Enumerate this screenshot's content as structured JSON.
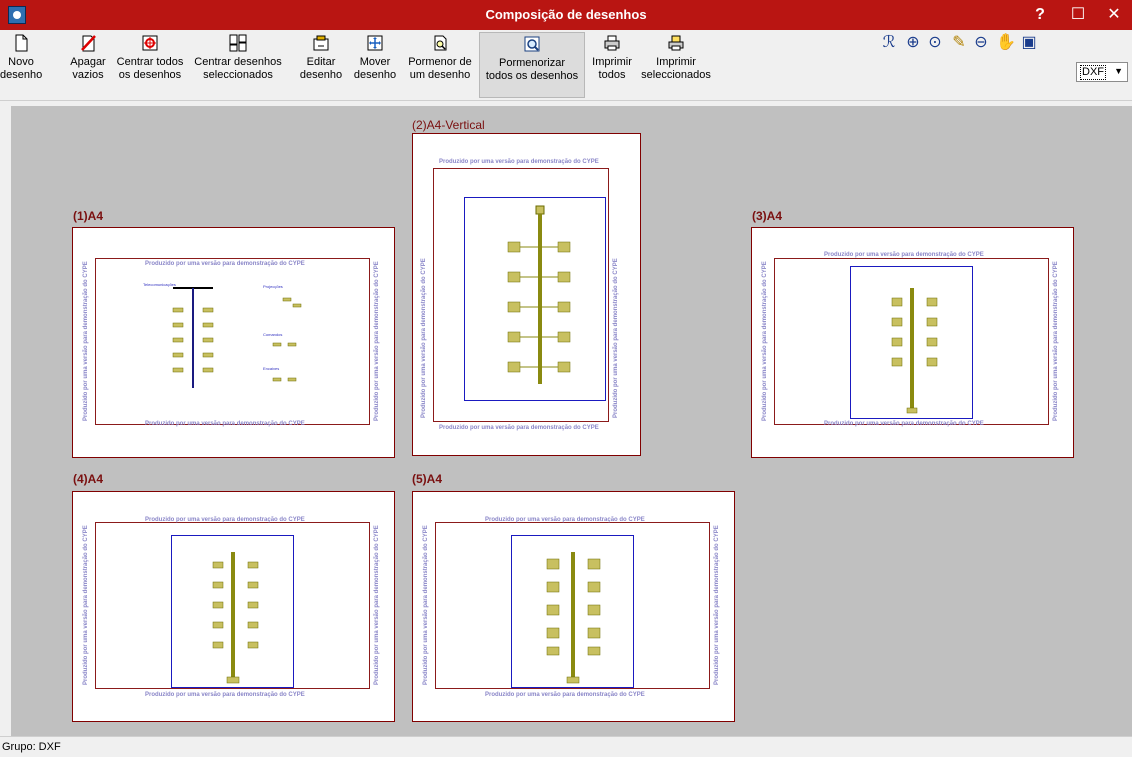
{
  "window": {
    "title": "Composição de desenhos",
    "help": "?",
    "maximize": "☐",
    "close": "✕",
    "title_color": "#b91512"
  },
  "toolbar": {
    "buttons": [
      {
        "label": "Novo\ndesenho",
        "icon": "new-page-icon"
      },
      {
        "label": "Apagar\nvazios",
        "icon": "delete-icon"
      },
      {
        "label": "Centrar todos\nos desenhos",
        "icon": "center-all-icon"
      },
      {
        "label": "Centrar desenhos\nseleccionados",
        "icon": "center-selected-icon"
      },
      {
        "label": "Editar\ndesenho",
        "icon": "edit-icon"
      },
      {
        "label": "Mover\ndesenho",
        "icon": "move-icon"
      },
      {
        "label": "Pormenor de\num desenho",
        "icon": "detail-icon"
      },
      {
        "label": "Pormenorizar\ntodos os desenhos",
        "icon": "detail-all-icon"
      },
      {
        "label": "Imprimir\ntodos",
        "icon": "print-icon"
      },
      {
        "label": "Imprimir\nseleccionados",
        "icon": "print-selected-icon"
      }
    ],
    "format_value": "DXF"
  },
  "sheets": [
    {
      "label": "(1)A4"
    },
    {
      "label": "(2)A4-Vertical"
    },
    {
      "label": "(3)A4"
    },
    {
      "label": "(4)A4"
    },
    {
      "label": "(5)A4"
    }
  ],
  "watermark": "Produzido por uma versão para demonstração do CYPE",
  "status": "Grupo: DXF"
}
